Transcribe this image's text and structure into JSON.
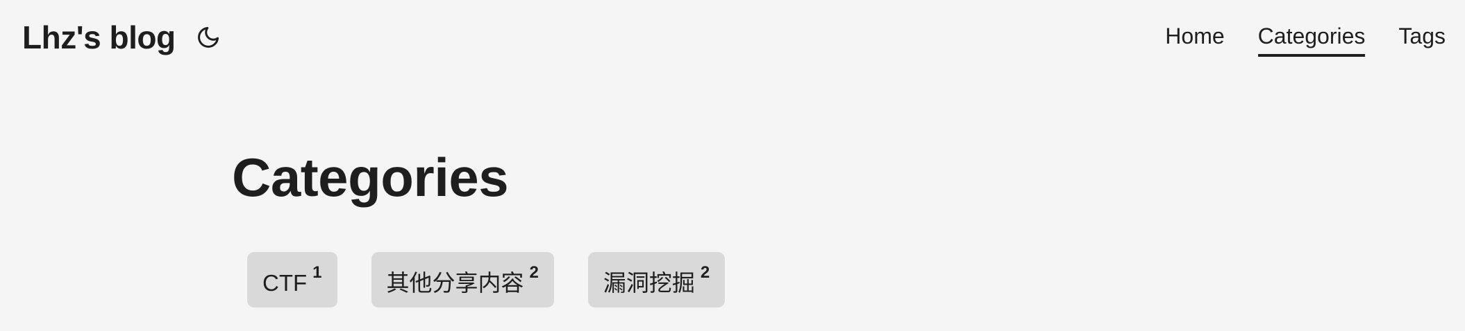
{
  "header": {
    "logo": "Lhz's blog",
    "theme_icon": "moon-icon",
    "nav": [
      {
        "label": "Home",
        "active": false
      },
      {
        "label": "Categories",
        "active": true
      },
      {
        "label": "Tags",
        "active": false
      }
    ]
  },
  "main": {
    "title": "Categories",
    "terms": [
      {
        "label": "CTF",
        "count": "1"
      },
      {
        "label": "其他分享内容",
        "count": "2"
      },
      {
        "label": "漏洞挖掘",
        "count": "2"
      }
    ]
  },
  "colors": {
    "background": "#f5f5f5",
    "text": "#1e1e1e",
    "tag_background": "#d9d9d9"
  }
}
